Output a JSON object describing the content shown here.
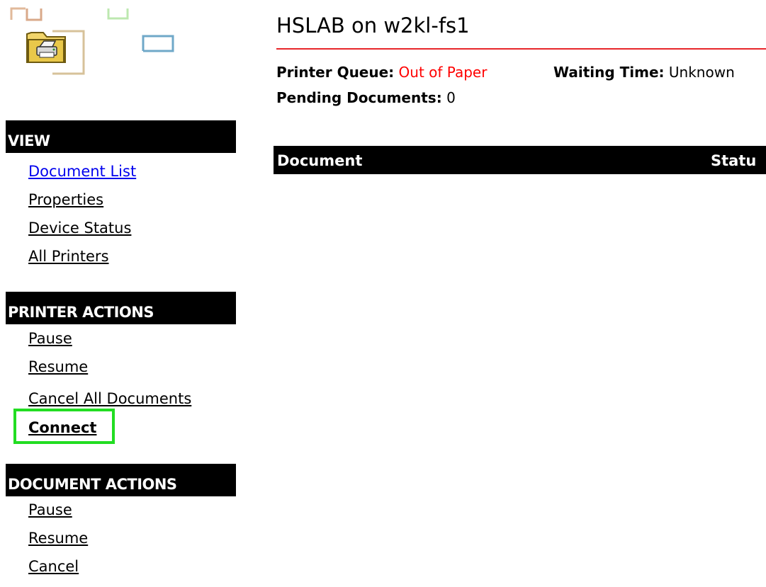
{
  "page": {
    "title": "HSLAB on w2kl-fs1"
  },
  "status": {
    "queue_label": "Printer Queue:",
    "queue_value": "Out of Paper",
    "wait_label": "Waiting Time:",
    "wait_value": "Unknown",
    "pending_label": "Pending Documents:",
    "pending_value": "0"
  },
  "table": {
    "columns": [
      "Document",
      "Statu"
    ]
  },
  "sidebar": {
    "view": {
      "header": "VIEW",
      "items": [
        {
          "label": "Document List"
        },
        {
          "label": "Properties"
        },
        {
          "label": "Device Status"
        },
        {
          "label": "All Printers"
        }
      ]
    },
    "printer_actions": {
      "header": "PRINTER ACTIONS",
      "items": [
        {
          "label": "Pause"
        },
        {
          "label": "Resume"
        },
        {
          "label": "Cancel All Documents"
        },
        {
          "label": "Connect"
        }
      ]
    },
    "document_actions": {
      "header": "DOCUMENT ACTIONS",
      "items": [
        {
          "label": "Pause"
        },
        {
          "label": "Resume"
        },
        {
          "label": "Cancel"
        }
      ]
    }
  },
  "icons": {
    "logo": "printer-folder-icon"
  },
  "colors": {
    "accent_rule": "#e8262a",
    "queue_status": "#ff0000",
    "active_link": "#0000ee",
    "highlight": "#22dd22",
    "header_bg": "#000000"
  }
}
